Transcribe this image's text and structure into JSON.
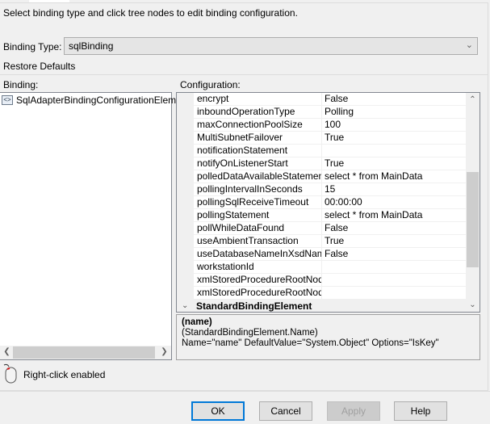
{
  "instruction": "Select binding type and click tree nodes to edit binding configuration.",
  "binding_type": {
    "label": "Binding Type:",
    "value": "sqlBinding"
  },
  "restore_defaults": "Restore Defaults",
  "binding_label": "Binding:",
  "configuration_label": "Configuration:",
  "tree": {
    "items": [
      {
        "label": "SqlAdapterBindingConfigurationElement",
        "icon": "binding-element-icon"
      }
    ]
  },
  "grid": {
    "rows": [
      {
        "name": "encrypt",
        "value": "False"
      },
      {
        "name": "inboundOperationType",
        "value": "Polling"
      },
      {
        "name": "maxConnectionPoolSize",
        "value": "100"
      },
      {
        "name": "MultiSubnetFailover",
        "value": "True"
      },
      {
        "name": "notificationStatement",
        "value": ""
      },
      {
        "name": "notifyOnListenerStart",
        "value": "True"
      },
      {
        "name": "polledDataAvailableStatement",
        "value": "select * from MainData"
      },
      {
        "name": "pollingIntervalInSeconds",
        "value": "15"
      },
      {
        "name": "pollingSqlReceiveTimeout",
        "value": "00:00:00"
      },
      {
        "name": "pollingStatement",
        "value": "select * from MainData"
      },
      {
        "name": "pollWhileDataFound",
        "value": "False"
      },
      {
        "name": "useAmbientTransaction",
        "value": "True"
      },
      {
        "name": "useDatabaseNameInXsdNamespace",
        "value": "False"
      },
      {
        "name": "workstationId",
        "value": ""
      },
      {
        "name": "xmlStoredProcedureRootNodeName",
        "value": ""
      },
      {
        "name": "xmlStoredProcedureRootNodeNamespace",
        "value": ""
      }
    ],
    "category": "StandardBindingElement"
  },
  "description": {
    "title": "(name)",
    "line1": "(StandardBindingElement.Name)",
    "line2": "Name=\"name\" DefaultValue=\"System.Object\" Options=\"IsKey\""
  },
  "right_click": "Right-click enabled",
  "buttons": {
    "ok": "OK",
    "cancel": "Cancel",
    "apply": "Apply",
    "help": "Help"
  },
  "colors": {
    "focus": "#0078d7"
  }
}
